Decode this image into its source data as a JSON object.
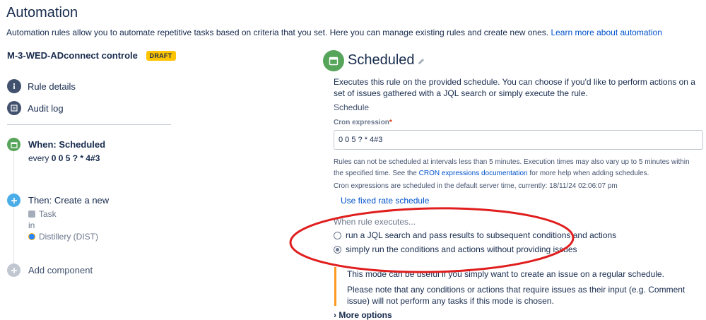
{
  "header": {
    "title": "Automation",
    "description": "Automation rules allow you to automate repetitive tasks based on criteria that you set. Here you can manage existing rules and create new ones.",
    "learn_more": "Learn more about automation"
  },
  "rule": {
    "name": "M-3-WED-ADconnect controle",
    "status_badge": "DRAFT"
  },
  "sidebar": {
    "items": [
      {
        "label": "Rule details",
        "icon": "info-icon"
      },
      {
        "label": "Audit log",
        "icon": "list-icon"
      }
    ]
  },
  "timeline": {
    "trigger": {
      "title": "When: Scheduled",
      "prefix": "every",
      "cron": "0 0 5 ? * 4#3",
      "icon": "calendar-icon",
      "color": "#57a55a"
    },
    "action": {
      "title": "Then: Create a new",
      "issue_type": "Task",
      "in_label": "in",
      "project": "Distillery (DIST)",
      "icon": "plus-icon",
      "color": "#4bade8"
    },
    "add": {
      "label": "Add component",
      "icon": "plus-icon",
      "color": "#c1c7d0"
    }
  },
  "panel": {
    "title": "Scheduled",
    "description": "Executes this rule on the provided schedule. You can choose if you'd like to perform actions on a set of issues gathered with a JQL search or simply execute the rule.",
    "schedule_heading": "Schedule",
    "cron_label": "Cron expression",
    "cron_value": "0 0 5 ? * 4#3",
    "note1_a": "Rules can not be scheduled at intervals less than 5 minutes. Execution times may also vary up to 5 minutes within the specified time. See the",
    "note1_link": "CRON expressions documentation",
    "note1_b": "for more help when adding schedules.",
    "note2": "Cron expressions are scheduled in the default server time, currently: 18/11/24 02:06:07 pm",
    "fixed_rate_link": "Use fixed rate schedule",
    "when_label": "When rule executes...",
    "options": [
      {
        "label": "run a JQL search and pass results to subsequent conditions and actions",
        "selected": false
      },
      {
        "label": "simply run the conditions and actions without providing issues",
        "selected": true
      }
    ],
    "info_line1": "This mode can be useful if you simply want to create an issue on a regular schedule.",
    "info_line2": "Please note that any conditions or actions that require issues as their input (e.g. Comment issue) will not perform any tasks if this mode is chosen.",
    "more_options": "More options"
  },
  "colors": {
    "accent_link": "#0052cc",
    "draft_badge": "#ffc400",
    "annotation_red": "#e01e1e",
    "info_bar": "#ff991f"
  }
}
